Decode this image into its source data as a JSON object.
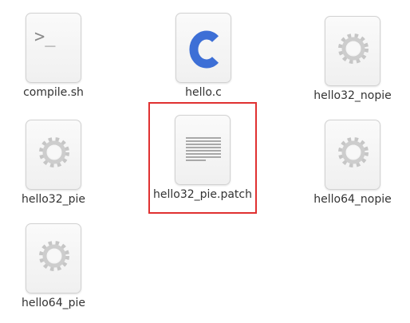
{
  "files": [
    {
      "name": "compile.sh",
      "icon": "terminal-script-icon"
    },
    {
      "name": "hello.c",
      "icon": "c-source-icon"
    },
    {
      "name": "hello32_nopie",
      "icon": "executable-gear-icon"
    },
    {
      "name": "hello32_pie",
      "icon": "executable-gear-icon"
    },
    {
      "name": "hello32_pie.patch",
      "icon": "text-document-icon"
    },
    {
      "name": "hello64_nopie",
      "icon": "executable-gear-icon"
    },
    {
      "name": "hello64_pie",
      "icon": "executable-gear-icon"
    }
  ],
  "selected_file": "hello32_pie.patch",
  "colors": {
    "selection_border": "#e03131",
    "c_letter": "#3d6fd6",
    "label_text": "#333333"
  }
}
